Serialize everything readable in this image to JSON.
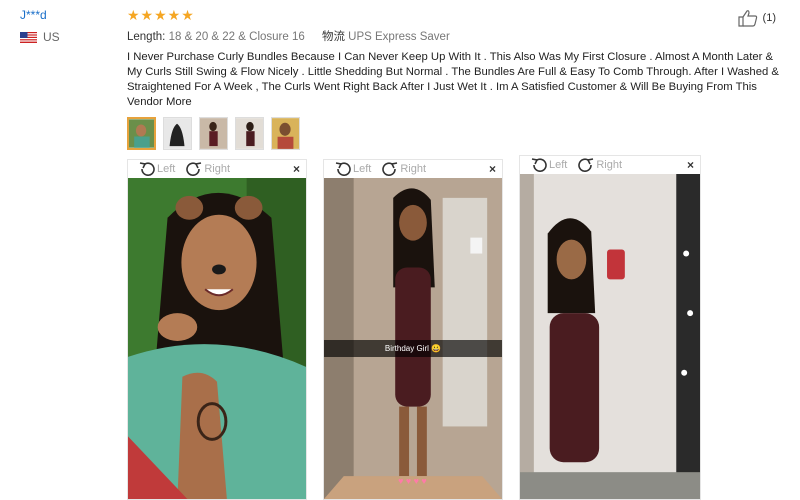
{
  "reviewer": {
    "name": "J***d",
    "country": "US"
  },
  "review": {
    "stars": "★★★★★",
    "length_label": "Length:",
    "length_value": "18 & 20 & 22 & Closure 16",
    "logistics_label": "物流",
    "logistics_value": "UPS Express Saver",
    "text": "I Never Purchase Curly Bundles Because I Can Never Keep Up With It . This Also Was My First Closure . Almost A Month Later & My Curls Still Swing & Flow Nicely . Little Shedding But Normal . The Bundles Are Full & Easy To Comb Through. After I Washed & Straightened For A Week , The Curls Went Right Back After I Just Wet It . Im A Satisfied Customer & Will Be Buying From This Vendor More",
    "helpful_count": "(1)"
  },
  "viewers": [
    {
      "left_label": "Left",
      "right_label": "Right",
      "close": "×"
    },
    {
      "left_label": "Left",
      "right_label": "Right",
      "close": "×",
      "caption": "Birthday Girl 😀"
    },
    {
      "left_label": "Left",
      "right_label": "Right",
      "close": "×"
    }
  ],
  "colors": {
    "accent_blue": "#1a6fc9",
    "star": "#f5a623",
    "thumb_active": "#e6a23c"
  }
}
